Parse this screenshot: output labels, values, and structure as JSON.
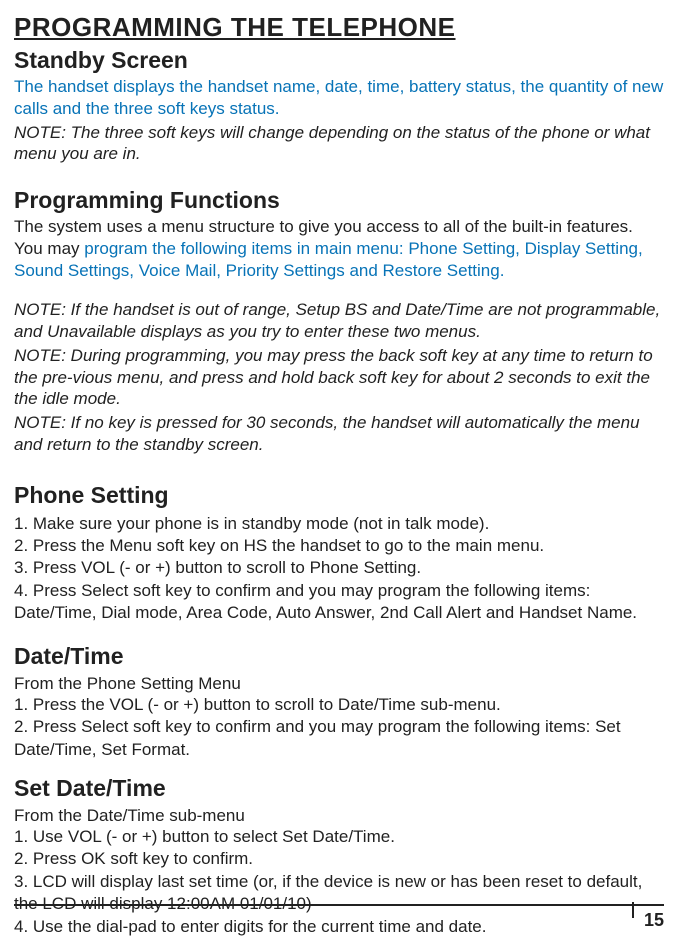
{
  "title": "PROGRAMMING THE TELEPHONE",
  "standby": {
    "heading": "Standby Screen",
    "highlight": "The handset displays the handset name, date, time, battery status, the quantity of new calls and the three soft keys status.",
    "note": "NOTE: The three soft keys will change depending on the status of the phone or what menu you are in."
  },
  "programming": {
    "heading": "Programming Functions",
    "lead_plain": "The system uses a menu structure to give you access to all of the built-in features. You may ",
    "lead_highlight": "program the following items in main menu: Phone Setting, Display Setting, Sound Settings, Voice Mail, Priority Settings and Restore Setting.",
    "note1": "NOTE: If the handset is out of range, Setup BS and Date/Time are not programmable, and Unavailable displays as you try to enter these two menus.",
    "note2": "NOTE: During programming, you may press the back soft key at any time to return to the pre-vious menu, and press and hold back soft key for about 2 seconds to exit the the idle mode.",
    "note3": "NOTE: If no key is pressed for 30 seconds, the handset will automatically the menu and return to the standby screen."
  },
  "phone_setting": {
    "heading": "Phone Setting",
    "l1": "1. Make sure your phone is in standby mode (not in talk mode).",
    "l2": "2. Press the Menu soft key on HS the handset to go to the main menu.",
    "l3": "3. Press VOL (- or +) button to scroll to Phone Setting.",
    "l4": "4. Press Select soft key to confirm and you may program the following items: Date/Time, Dial mode,  Area Code, Auto Answer,  2nd Call Alert and Handset Name."
  },
  "date_time": {
    "heading": "Date/Time",
    "lead": "From the Phone Setting Menu",
    "l1": "1. Press the VOL (- or +) button to scroll to Date/Time sub-menu.",
    "l2": "2. Press Select soft key to confirm and you may program the following items: Set Date/Time, Set Format."
  },
  "set_date_time": {
    "heading": "Set Date/Time",
    "lead": "From the Date/Time sub-menu",
    "l1": "1. Use VOL (- or +) button to select Set Date/Time.",
    "l2": "2. Press OK soft key to confirm.",
    "l3": "3. LCD will display last set time (or, if the device is new or has been reset to default, the LCD will display 12:00AM 01/01/10)",
    "l4": "4. Use the dial-pad to enter digits for the current time and date."
  },
  "page_number": "15"
}
